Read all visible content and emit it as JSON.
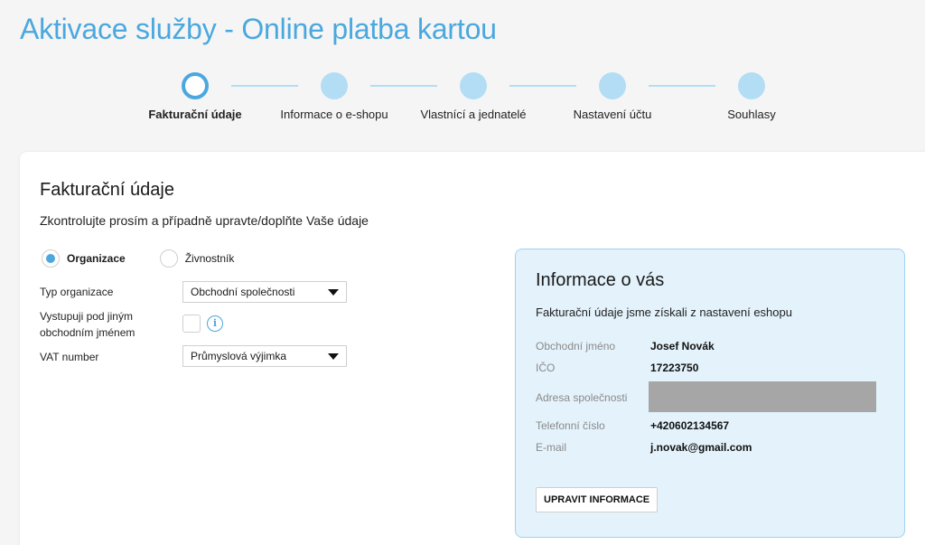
{
  "page": {
    "title": "Aktivace služby - Online platba kartou"
  },
  "stepper": {
    "steps": [
      {
        "label": "Fakturační údaje",
        "active": true
      },
      {
        "label": "Informace o e-shopu",
        "active": false
      },
      {
        "label": "Vlastnící a jednatelé",
        "active": false
      },
      {
        "label": "Nastavení účtu",
        "active": false
      },
      {
        "label": "Souhlasy",
        "active": false
      }
    ]
  },
  "form": {
    "title": "Fakturační údaje",
    "subtitle": "Zkontrolujte prosím a případně upravte/doplňte Vaše údaje",
    "entity_type": {
      "options": [
        {
          "label": "Organizace",
          "checked": true
        },
        {
          "label": "Živnostník",
          "checked": false
        }
      ]
    },
    "org_type": {
      "label": "Typ organizace",
      "value": "Obchodní společnosti"
    },
    "trade_name": {
      "label_line1": "Vystupuji pod jiným",
      "label_line2": "obchodním jménem",
      "checked": false,
      "info_icon": "info-icon"
    },
    "vat": {
      "label": "VAT number",
      "value": "Průmyslová výjimka"
    }
  },
  "info": {
    "title": "Informace o vás",
    "subtitle": "Fakturační údaje jsme získali z nastavení eshopu",
    "rows": [
      {
        "key": "Obchodní jméno",
        "value": "Josef Novák"
      },
      {
        "key": "IČO",
        "value": "17223750"
      },
      {
        "key": "Adresa společnosti",
        "value": ""
      },
      {
        "key": "Telefonní číslo",
        "value": "+420602134567"
      },
      {
        "key": "E-mail",
        "value": "j.novak@gmail.com"
      }
    ],
    "button_label": "UPRAVIT INFORMACE"
  },
  "colors": {
    "accent": "#4aa8df",
    "accent_light": "#b3ddf5",
    "panel_bg": "#e3f2fb"
  }
}
